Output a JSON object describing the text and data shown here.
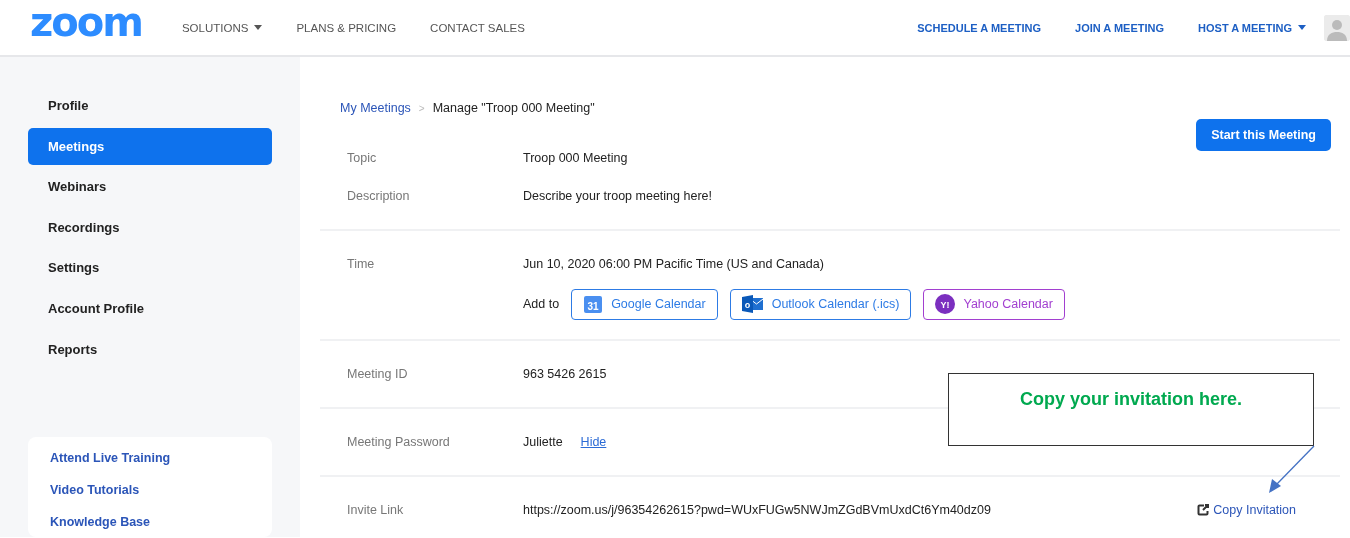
{
  "header": {
    "logo": "zoom",
    "left_nav": [
      {
        "label": "SOLUTIONS",
        "dropdown": true
      },
      {
        "label": "PLANS & PRICING",
        "dropdown": false
      },
      {
        "label": "CONTACT SALES",
        "dropdown": false
      }
    ],
    "right_nav": [
      {
        "label": "SCHEDULE A MEETING",
        "dropdown": false
      },
      {
        "label": "JOIN A MEETING",
        "dropdown": false
      },
      {
        "label": "HOST A MEETING",
        "dropdown": true
      }
    ]
  },
  "sidebar": {
    "items": [
      {
        "label": "Profile",
        "selected": false
      },
      {
        "label": "Meetings",
        "selected": true
      },
      {
        "label": "Webinars",
        "selected": false
      },
      {
        "label": "Recordings",
        "selected": false
      },
      {
        "label": "Settings",
        "selected": false
      },
      {
        "label": "Account Profile",
        "selected": false
      },
      {
        "label": "Reports",
        "selected": false
      }
    ],
    "help_links": [
      "Attend Live Training",
      "Video Tutorials",
      "Knowledge Base"
    ]
  },
  "breadcrumb": {
    "link": "My Meetings",
    "separator": ">",
    "current": "Manage \"Troop 000 Meeting\""
  },
  "start_button": "Start this Meeting",
  "sections": [
    {
      "fields": [
        {
          "label": "Topic",
          "value": "Troop 000 Meeting"
        },
        {
          "label": "Description",
          "value": "Describe your troop meeting here!"
        }
      ]
    },
    {
      "fields": [
        {
          "label": "Time",
          "value": "Jun 10, 2020 06:00 PM Pacific Time (US and Canada)"
        }
      ],
      "add_to": {
        "label": "Add to",
        "calendars": [
          {
            "kind": "google",
            "icon_text": "31",
            "label": "Google Calendar",
            "color": "#2d7be5"
          },
          {
            "kind": "outlook",
            "icon_text": "o",
            "label": "Outlook Calendar (.ics)",
            "color": "#2d7be5"
          },
          {
            "kind": "yahoo",
            "icon_text": "Y!",
            "label": "Yahoo Calendar",
            "color": "#a23fd0"
          }
        ]
      }
    },
    {
      "fields": [
        {
          "label": "Meeting ID",
          "value": "963 5426 2615"
        }
      ]
    },
    {
      "fields": [
        {
          "label": "Meeting Password",
          "value": "Juliette",
          "link": "Hide"
        }
      ]
    },
    {
      "fields": [
        {
          "label": "Invite Link",
          "value": "https://zoom.us/j/96354262615?pwd=WUxFUGw5NWJmZGdBVmUxdCt6Ym40dz09",
          "action": "Copy Invitation"
        }
      ]
    }
  ],
  "callout": {
    "text": "Copy your invitation here."
  }
}
